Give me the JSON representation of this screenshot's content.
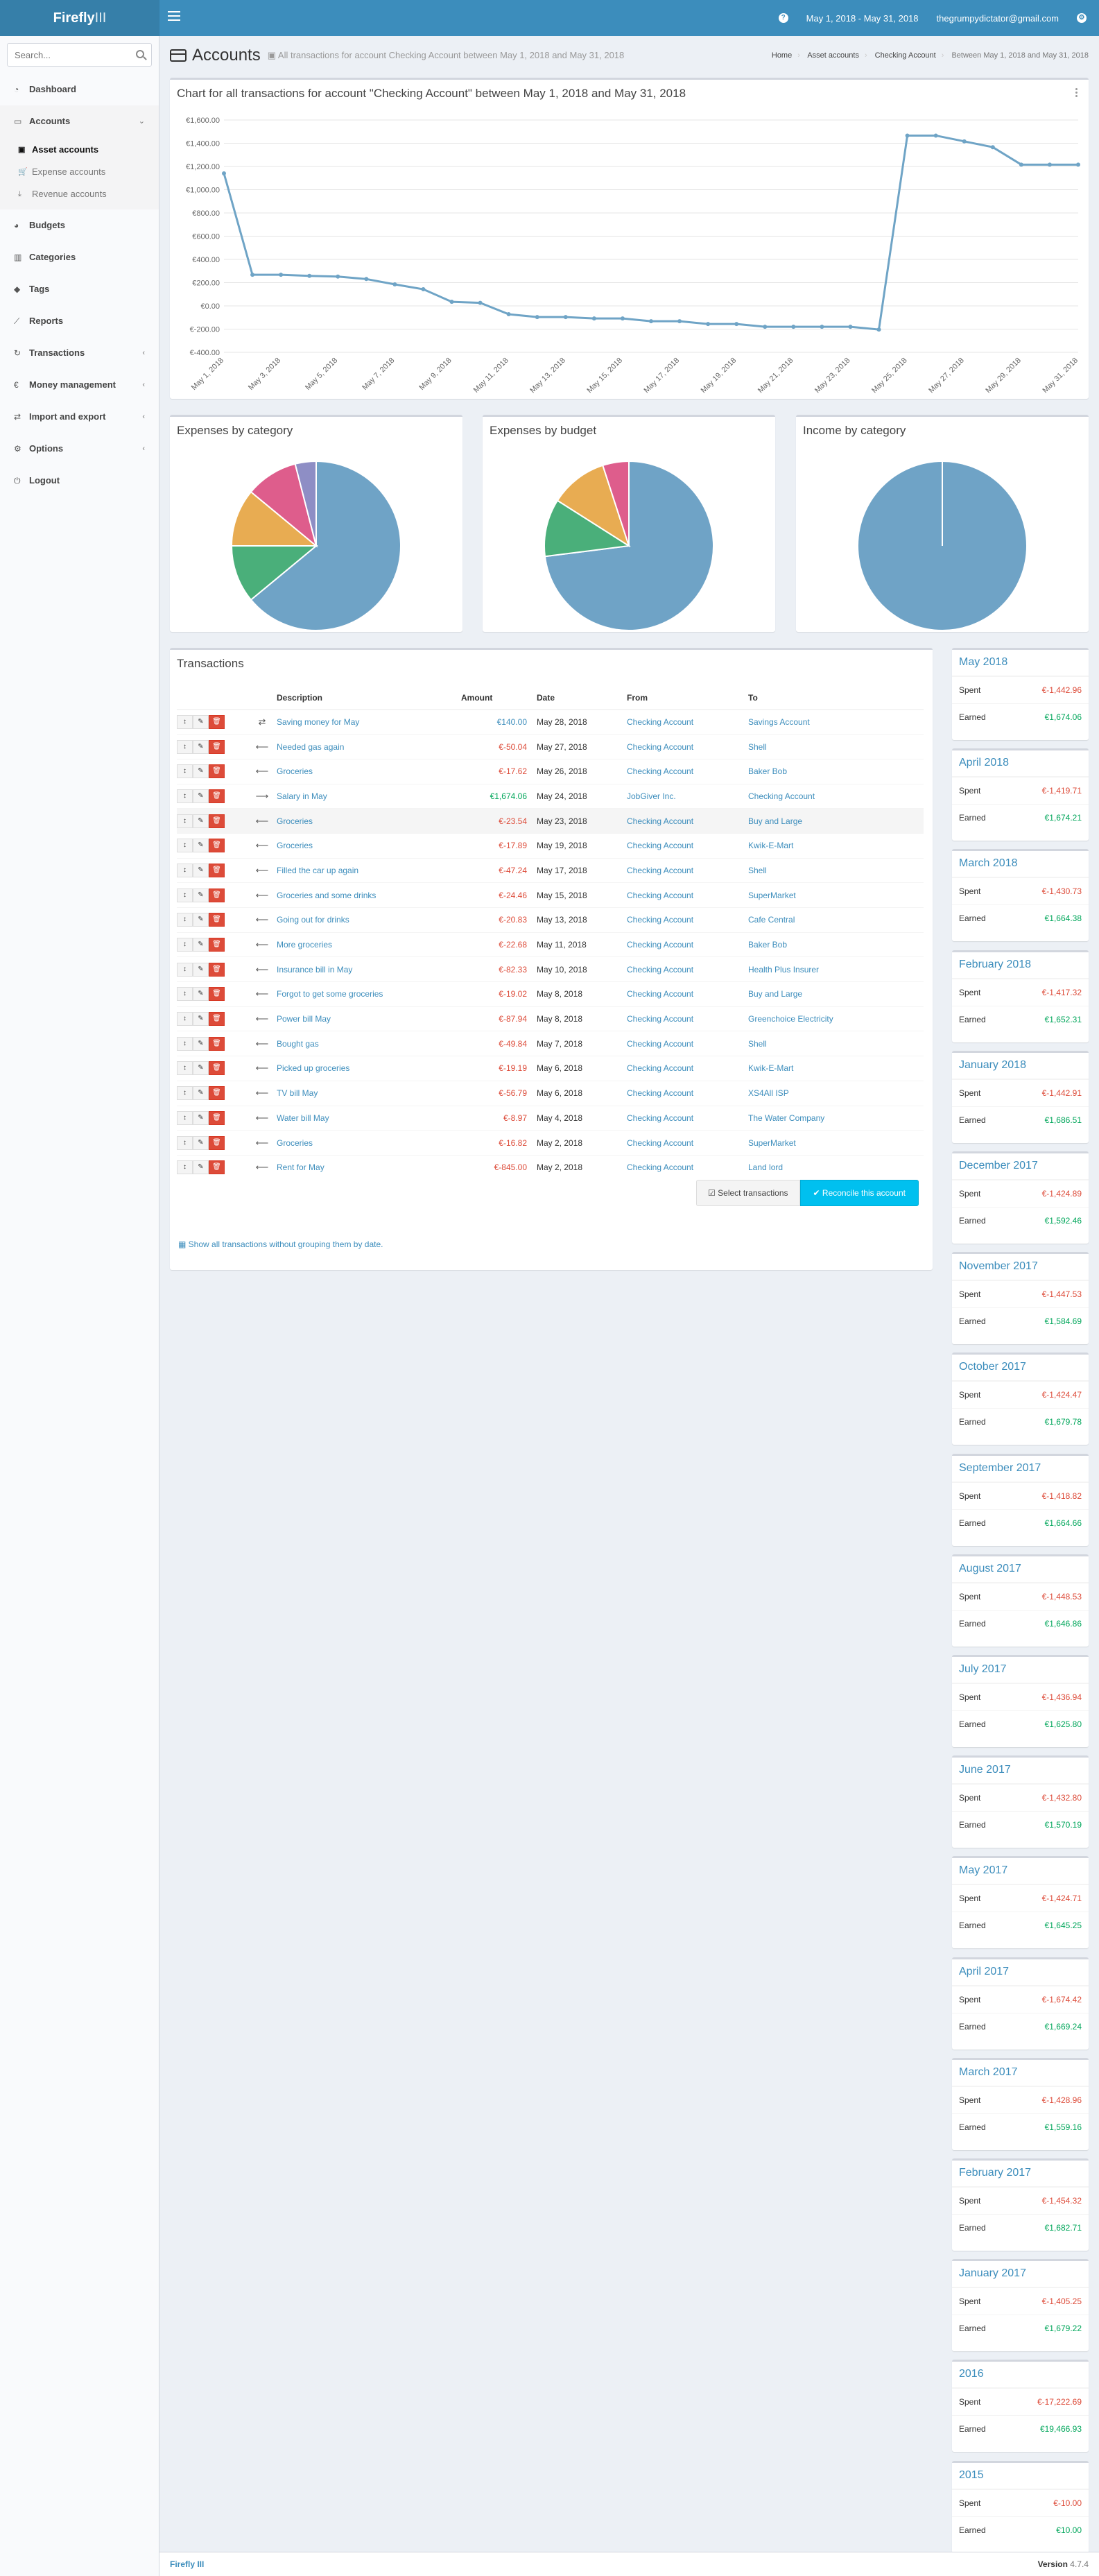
{
  "app": {
    "logo_bold": "Firefly",
    "logo_light": "III"
  },
  "header": {
    "help_icon": "question-circle-icon",
    "date_range": "May 1, 2018 - May 31, 2018",
    "user_email": "thegrumpydictator@gmail.com",
    "settings_icon": "cog-icon"
  },
  "sidebar": {
    "search_placeholder": "Search...",
    "items": [
      {
        "label": "Dashboard",
        "icon": "dashboard-icon"
      },
      {
        "label": "Accounts",
        "icon": "credit-card-icon"
      },
      {
        "label": "Budgets",
        "icon": "pie-chart-icon"
      },
      {
        "label": "Categories",
        "icon": "bar-chart-icon"
      },
      {
        "label": "Tags",
        "icon": "tag-icon"
      },
      {
        "label": "Reports",
        "icon": "line-chart-icon"
      },
      {
        "label": "Transactions",
        "icon": "repeat-icon"
      },
      {
        "label": "Money management",
        "icon": "euro-icon"
      },
      {
        "label": "Import and export",
        "icon": "import-icon"
      },
      {
        "label": "Options",
        "icon": "gear-icon"
      },
      {
        "label": "Logout",
        "icon": "logout-icon"
      }
    ],
    "sub_items": [
      {
        "label": "Asset accounts",
        "icon": "money-icon"
      },
      {
        "label": "Expense accounts",
        "icon": "cart-icon"
      },
      {
        "label": "Revenue accounts",
        "icon": "download-icon"
      }
    ]
  },
  "page": {
    "title": "Accounts",
    "subtitle": "All transactions for account Checking Account between May 1, 2018 and May 31, 2018",
    "breadcrumbs": [
      "Home",
      "Asset accounts",
      "Checking Account",
      "Between May 1, 2018 and May 31, 2018"
    ]
  },
  "chart_data": [
    {
      "type": "line",
      "title": "Chart for all transactions for account \"Checking Account\" between May 1, 2018 and May 31, 2018",
      "ylim": [
        -400,
        1600
      ],
      "y_ticks": [
        "€-400.00",
        "€-200.00",
        "€0.00",
        "€200.00",
        "€400.00",
        "€600.00",
        "€800.00",
        "€1,000.00",
        "€1,200.00",
        "€1,400.00",
        "€1,600.00"
      ],
      "x_ticks": [
        "May 1, 2018",
        "May 3, 2018",
        "May 5, 2018",
        "May 7, 2018",
        "May 9, 2018",
        "May 11, 2018",
        "May 13, 2018",
        "May 15, 2018",
        "May 17, 2018",
        "May 19, 2018",
        "May 21, 2018",
        "May 23, 2018",
        "May 25, 2018",
        "May 27, 2018",
        "May 29, 2018",
        "May 31, 2018"
      ],
      "x": [
        "May 1",
        "May 2",
        "May 3",
        "May 4",
        "May 5",
        "May 6",
        "May 7",
        "May 8",
        "May 9",
        "May 10",
        "May 11",
        "May 12",
        "May 13",
        "May 14",
        "May 15",
        "May 16",
        "May 17",
        "May 18",
        "May 19",
        "May 20",
        "May 21",
        "May 22",
        "May 23",
        "May 24",
        "May 25",
        "May 26",
        "May 27",
        "May 28",
        "May 29",
        "May 30",
        "May 31"
      ],
      "values": [
        1140,
        268,
        268,
        258,
        252,
        231,
        185,
        143,
        35,
        26,
        -72,
        -96,
        -96,
        -108,
        -108,
        -132,
        -132,
        -156,
        -156,
        -180,
        -180,
        -180,
        -180,
        -204,
        1466,
        1466,
        1416,
        1366,
        1216,
        1216,
        1216
      ],
      "grid": true,
      "color": "#6fa4c6"
    },
    {
      "type": "pie",
      "title": "Expenses by category",
      "slices": [
        {
          "value": 64,
          "color": "#6fa3c6"
        },
        {
          "value": 11,
          "color": "#4aaf7a"
        },
        {
          "value": 11,
          "color": "#e8ac52"
        },
        {
          "value": 10,
          "color": "#de5d8c"
        },
        {
          "value": 4,
          "color": "#8e8ec5"
        }
      ]
    },
    {
      "type": "pie",
      "title": "Expenses by budget",
      "slices": [
        {
          "value": 73,
          "color": "#6fa3c6"
        },
        {
          "value": 11,
          "color": "#4aaf7a"
        },
        {
          "value": 11,
          "color": "#e8ac52"
        },
        {
          "value": 5,
          "color": "#de5d8c"
        }
      ]
    },
    {
      "type": "pie",
      "title": "Income by category",
      "slices": [
        {
          "value": 100,
          "color": "#6fa3c6"
        }
      ]
    }
  ],
  "transactions": {
    "title": "Transactions",
    "headers": [
      "",
      "",
      "Description",
      "Amount",
      "Date",
      "From",
      "To"
    ],
    "rows": [
      {
        "type": "transfer",
        "description": "Saving money for May",
        "amount": "€140.00",
        "sign": "pos-blue",
        "date": "May 28, 2018",
        "from": "Checking Account",
        "to": "Savings Account"
      },
      {
        "type": "withdrawal",
        "description": "Needed gas again",
        "amount": "€-50.04",
        "sign": "neg",
        "date": "May 27, 2018",
        "from": "Checking Account",
        "to": "Shell"
      },
      {
        "type": "withdrawal",
        "description": "Groceries",
        "amount": "€-17.62",
        "sign": "neg",
        "date": "May 26, 2018",
        "from": "Checking Account",
        "to": "Baker Bob"
      },
      {
        "type": "deposit",
        "description": "Salary in May",
        "amount": "€1,674.06",
        "sign": "pos",
        "date": "May 24, 2018",
        "from": "JobGiver Inc.",
        "to": "Checking Account"
      },
      {
        "type": "withdrawal",
        "description": "Groceries",
        "amount": "€-23.54",
        "sign": "neg",
        "date": "May 23, 2018",
        "from": "Checking Account",
        "to": "Buy and Large"
      },
      {
        "type": "withdrawal",
        "description": "Groceries",
        "amount": "€-17.89",
        "sign": "neg",
        "date": "May 19, 2018",
        "from": "Checking Account",
        "to": "Kwik-E-Mart"
      },
      {
        "type": "withdrawal",
        "description": "Filled the car up again",
        "amount": "€-47.24",
        "sign": "neg",
        "date": "May 17, 2018",
        "from": "Checking Account",
        "to": "Shell"
      },
      {
        "type": "withdrawal",
        "description": "Groceries and some drinks",
        "amount": "€-24.46",
        "sign": "neg",
        "date": "May 15, 2018",
        "from": "Checking Account",
        "to": "SuperMarket"
      },
      {
        "type": "withdrawal",
        "description": "Going out for drinks",
        "amount": "€-20.83",
        "sign": "neg",
        "date": "May 13, 2018",
        "from": "Checking Account",
        "to": "Cafe Central"
      },
      {
        "type": "withdrawal",
        "description": "More groceries",
        "amount": "€-22.68",
        "sign": "neg",
        "date": "May 11, 2018",
        "from": "Checking Account",
        "to": "Baker Bob"
      },
      {
        "type": "withdrawal",
        "description": "Insurance bill in May",
        "amount": "€-82.33",
        "sign": "neg",
        "date": "May 10, 2018",
        "from": "Checking Account",
        "to": "Health Plus Insurer"
      },
      {
        "type": "withdrawal",
        "description": "Forgot to get some groceries",
        "amount": "€-19.02",
        "sign": "neg",
        "date": "May 8, 2018",
        "from": "Checking Account",
        "to": "Buy and Large"
      },
      {
        "type": "withdrawal",
        "description": "Power bill May",
        "amount": "€-87.94",
        "sign": "neg",
        "date": "May 8, 2018",
        "from": "Checking Account",
        "to": "Greenchoice Electricity"
      },
      {
        "type": "withdrawal",
        "description": "Bought gas",
        "amount": "€-49.84",
        "sign": "neg",
        "date": "May 7, 2018",
        "from": "Checking Account",
        "to": "Shell"
      },
      {
        "type": "withdrawal",
        "description": "Picked up groceries",
        "amount": "€-19.19",
        "sign": "neg",
        "date": "May 6, 2018",
        "from": "Checking Account",
        "to": "Kwik-E-Mart"
      },
      {
        "type": "withdrawal",
        "description": "TV bill May",
        "amount": "€-56.79",
        "sign": "neg",
        "date": "May 6, 2018",
        "from": "Checking Account",
        "to": "XS4All ISP"
      },
      {
        "type": "withdrawal",
        "description": "Water bill May",
        "amount": "€-8.97",
        "sign": "neg",
        "date": "May 4, 2018",
        "from": "Checking Account",
        "to": "The Water Company"
      },
      {
        "type": "withdrawal",
        "description": "Groceries",
        "amount": "€-16.82",
        "sign": "neg",
        "date": "May 2, 2018",
        "from": "Checking Account",
        "to": "SuperMarket"
      },
      {
        "type": "withdrawal",
        "description": "Rent for May",
        "amount": "€-845.00",
        "sign": "neg",
        "date": "May 2, 2018",
        "from": "Checking Account",
        "to": "Land lord"
      }
    ],
    "select_label": "Select transactions",
    "reconcile_label": "Reconcile this account",
    "show_all_label": "Show all transactions without grouping them by date."
  },
  "periods": [
    {
      "title": "May 2018",
      "spent": "€-1,442.96",
      "earned": "€1,674.06"
    },
    {
      "title": "April 2018",
      "spent": "€-1,419.71",
      "earned": "€1,674.21"
    },
    {
      "title": "March 2018",
      "spent": "€-1,430.73",
      "earned": "€1,664.38"
    },
    {
      "title": "February 2018",
      "spent": "€-1,417.32",
      "earned": "€1,652.31"
    },
    {
      "title": "January 2018",
      "spent": "€-1,442.91",
      "earned": "€1,686.51"
    },
    {
      "title": "December 2017",
      "spent": "€-1,424.89",
      "earned": "€1,592.46"
    },
    {
      "title": "November 2017",
      "spent": "€-1,447.53",
      "earned": "€1,584.69"
    },
    {
      "title": "October 2017",
      "spent": "€-1,424.47",
      "earned": "€1,679.78"
    },
    {
      "title": "September 2017",
      "spent": "€-1,418.82",
      "earned": "€1,664.66"
    },
    {
      "title": "August 2017",
      "spent": "€-1,448.53",
      "earned": "€1,646.86"
    },
    {
      "title": "July 2017",
      "spent": "€-1,436.94",
      "earned": "€1,625.80"
    },
    {
      "title": "June 2017",
      "spent": "€-1,432.80",
      "earned": "€1,570.19"
    },
    {
      "title": "May 2017",
      "spent": "€-1,424.71",
      "earned": "€1,645.25"
    },
    {
      "title": "April 2017",
      "spent": "€-1,674.42",
      "earned": "€1,669.24"
    },
    {
      "title": "March 2017",
      "spent": "€-1,428.96",
      "earned": "€1,559.16"
    },
    {
      "title": "February 2017",
      "spent": "€-1,454.32",
      "earned": "€1,682.71"
    },
    {
      "title": "January 2017",
      "spent": "€-1,405.25",
      "earned": "€1,679.22"
    },
    {
      "title": "2016",
      "spent": "€-17,222.69",
      "earned": "€19,466.93"
    },
    {
      "title": "2015",
      "spent": "€-10.00",
      "earned": "€10.00"
    }
  ],
  "period_labels": {
    "spent": "Spent",
    "earned": "Earned"
  },
  "footer": {
    "left": "Firefly III",
    "version_label": "Version",
    "version": "4.7.4"
  }
}
